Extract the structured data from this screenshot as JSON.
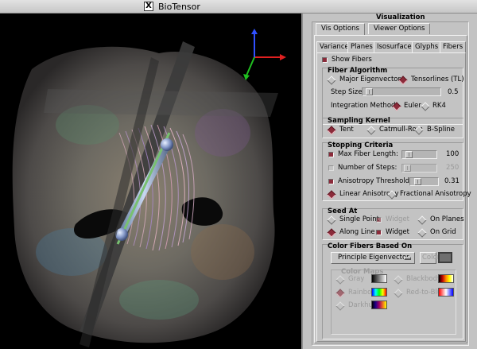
{
  "window": {
    "title": "BioTensor"
  },
  "panel": {
    "title": "Visualization",
    "top_tabs": [
      "Vis Options",
      "Viewer Options"
    ],
    "sub_tabs": [
      "Variance",
      "Planes",
      "Isosurface",
      "Glyphs",
      "Fibers"
    ],
    "show_fibers": "Show Fibers",
    "fiber_algorithm": {
      "title": "Fiber Algorithm",
      "major_eigenvector": "Major Eigenvector",
      "tensorlines": "Tensorlines (TL)",
      "step_size_label": "Step Size:",
      "step_size_value": "0.5",
      "integration_label": "Integration Method:",
      "euler": "Euler",
      "rk4": "RK4"
    },
    "sampling_kernel": {
      "title": "Sampling Kernel",
      "tent": "Tent",
      "catmull_rom": "Catmull-Rom",
      "bspline": "B-Spline"
    },
    "stopping_criteria": {
      "title": "Stopping Criteria",
      "max_fiber_length": "Max Fiber Length:",
      "max_fiber_length_value": "100",
      "number_of_steps": "Number of Steps:",
      "number_of_steps_value": "250",
      "anisotropy_threshold": "Anisotropy Threshold:",
      "anisotropy_threshold_value": "0.31",
      "linear_anisotropy": "Linear Anisotropy",
      "fractional_anisotropy": "Fractional Anisotropy"
    },
    "seed_at": {
      "title": "Seed At",
      "single_point": "Single Point",
      "widget_dim": "Widget",
      "on_planes": "On Planes",
      "along_line": "Along Line",
      "widget": "Widget",
      "on_grid": "On Grid"
    },
    "color_fibers": {
      "title": "Color Fibers Based On",
      "selected": "Principle Eigenvector",
      "color_button": "Color",
      "color_maps_title": "Color Maps",
      "gray": "Gray",
      "blackbody": "Blackbody",
      "rainbow": "Rainbow",
      "red_to_blue": "Red-to-Blue",
      "darkhue": "Darkhue"
    }
  },
  "colors": {
    "accent_selected": "#8b2b3a",
    "panel_bg": "#c3c3c3",
    "axis_x": "#e02020",
    "axis_y": "#20c020",
    "axis_z": "#2040ff"
  }
}
